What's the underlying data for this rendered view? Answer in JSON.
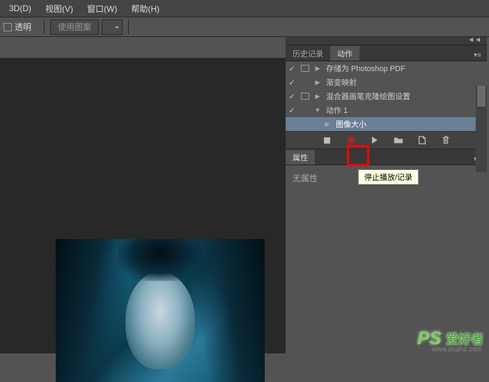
{
  "menu": {
    "item_3d": "3D(D)",
    "item_view": "视图(V)",
    "item_window": "窗口(W)",
    "item_help": "帮助(H)"
  },
  "options": {
    "transparent_label": "透明",
    "use_pattern_label": "使用图案"
  },
  "panels": {
    "collapse_glyph": "◄◄",
    "history_tab": "历史记录",
    "actions_tab": "动作",
    "properties_tab": "属性",
    "no_properties": "无属性"
  },
  "actions": [
    {
      "check": true,
      "dialog": true,
      "indent": 0,
      "expand": "▶",
      "label": "存储为 Photoshop PDF"
    },
    {
      "check": true,
      "dialog": false,
      "indent": 0,
      "expand": "▶",
      "label": "渐变映射"
    },
    {
      "check": true,
      "dialog": true,
      "indent": 0,
      "expand": "▶",
      "label": "混合器画笔克隆绘图设置"
    },
    {
      "check": true,
      "dialog": false,
      "indent": 0,
      "expand": "▼",
      "label": "动作 1"
    },
    {
      "check": false,
      "dialog": false,
      "indent": 1,
      "expand": "▶",
      "label": "图像大小",
      "selected": true
    }
  ],
  "controls": {
    "tooltip": "停止播放/记录"
  },
  "watermark": {
    "ps": "PS",
    "text": "爱好者",
    "domain": "www.psahz.com"
  }
}
